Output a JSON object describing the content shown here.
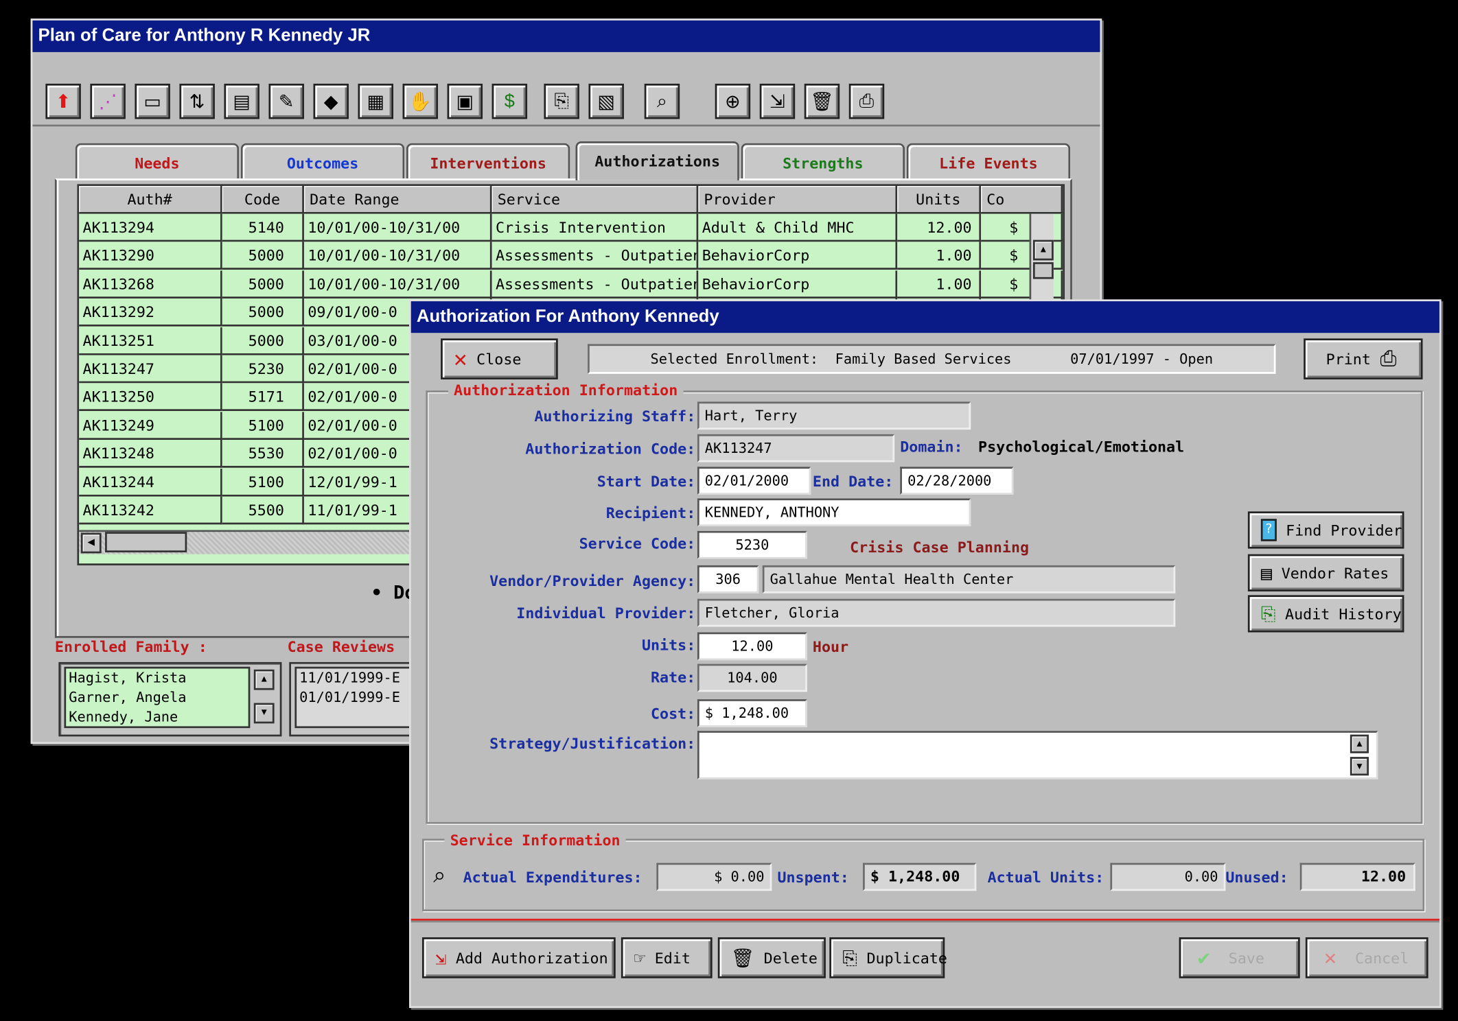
{
  "main_window": {
    "title": "Plan of Care for Anthony R Kennedy JR",
    "toolbar_icons": [
      "up-arrow-icon",
      "flowchart-icon",
      "window-icon",
      "sort-icon",
      "list-icon",
      "form-edit-icon",
      "shapes-icon",
      "cards-icon",
      "handshake-icon",
      "calendar-icon",
      "dollar-icon",
      "copy-icon",
      "preview-icon",
      "magnifier-icon",
      "binoculars-icon",
      "add-doc-icon",
      "trash-icon",
      "printer-icon"
    ],
    "toolbar_glyphs": [
      "⬆",
      "⋰",
      "▭",
      "⇅",
      "▤",
      "✎",
      "◆",
      "▦",
      "✋",
      "▣",
      "$",
      "⎘",
      "▧",
      "⌕",
      "⊕",
      "⇲",
      "🗑",
      "⎙"
    ],
    "tabs": [
      {
        "label": "Needs",
        "color": "#c0171b"
      },
      {
        "label": "Outcomes",
        "color": "#1538d4"
      },
      {
        "label": "Interventions",
        "color": "#a11a1a"
      },
      {
        "label": "Authorizations",
        "color": "#111111"
      },
      {
        "label": "Strengths",
        "color": "#1c7a1c"
      },
      {
        "label": "Life Events",
        "color": "#a11a1a"
      }
    ],
    "table": {
      "headers": [
        "Auth#",
        "Code",
        "Date Range",
        "Service",
        "Provider",
        "Units",
        "Co"
      ],
      "rows": [
        [
          "AK113294",
          "5140",
          "10/01/00-10/31/00",
          "Crisis Intervention",
          "Adult & Child MHC",
          "12.00",
          "$"
        ],
        [
          "AK113290",
          "5000",
          "10/01/00-10/31/00",
          "Assessments - Outpatien",
          "BehaviorCorp",
          "1.00",
          "$"
        ],
        [
          "AK113268",
          "5000",
          "10/01/00-10/31/00",
          "Assessments - Outpatien",
          "BehaviorCorp",
          "1.00",
          "$"
        ],
        [
          "AK113292",
          "5000",
          "09/01/00-0",
          "",
          "",
          "",
          ""
        ],
        [
          "AK113251",
          "5000",
          "03/01/00-0",
          "",
          "",
          "",
          ""
        ],
        [
          "AK113247",
          "5230",
          "02/01/00-0",
          "",
          "",
          "",
          ""
        ],
        [
          "AK113250",
          "5171",
          "02/01/00-0",
          "",
          "",
          "",
          ""
        ],
        [
          "AK113249",
          "5100",
          "02/01/00-0",
          "",
          "",
          "",
          ""
        ],
        [
          "AK113248",
          "5530",
          "02/01/00-0",
          "",
          "",
          "",
          ""
        ],
        [
          "AK113244",
          "5100",
          "12/01/99-1",
          "",
          "",
          "",
          ""
        ],
        [
          "AK113242",
          "5500",
          "11/01/99-1",
          "",
          "",
          "",
          ""
        ]
      ]
    },
    "partial_text": "• Do",
    "enrolled_family": {
      "label": "Enrolled Family :",
      "members": [
        "Hagist, Krista",
        "Garner, Angela",
        "Kennedy, Jane"
      ]
    },
    "case_reviews": {
      "label": "Case Reviews",
      "items": [
        "11/01/1999-E",
        "01/01/1999-E"
      ]
    }
  },
  "dialog": {
    "title": "Authorization For Anthony Kennedy",
    "close_label": "Close",
    "enrollment_text": "Selected Enrollment:  Family Based Services       07/01/1997 - Open",
    "print_label": "Print",
    "auth_info_title": "Authorization Information",
    "fields": {
      "authorizing_staff": {
        "label": "Authorizing Staff:",
        "value": "Hart, Terry"
      },
      "authorization_code": {
        "label": "Authorization Code:",
        "value": "AK113247"
      },
      "domain_label": "Domain:",
      "domain_value": "Psychological/Emotional",
      "start_date": {
        "label": "Start Date:",
        "value": "02/01/2000"
      },
      "end_date": {
        "label": "End Date:",
        "value": "02/28/2000"
      },
      "recipient": {
        "label": "Recipient:",
        "value": "KENNEDY, ANTHONY"
      },
      "service_code": {
        "label": "Service Code:",
        "value": "5230"
      },
      "service_name": "Crisis Case Planning",
      "vendor": {
        "label": "Vendor/Provider Agency:",
        "code": "306",
        "name": "Gallahue Mental Health Center"
      },
      "individual_provider": {
        "label": "Individual Provider:",
        "value": "Fletcher, Gloria"
      },
      "units": {
        "label": "Units:",
        "value": "12.00",
        "unit_name": "Hour"
      },
      "rate": {
        "label": "Rate:",
        "value": "104.00"
      },
      "cost": {
        "label": "Cost:",
        "value": "$ 1,248.00"
      },
      "strategy": {
        "label": "Strategy/Justification:",
        "value": ""
      }
    },
    "side_buttons": {
      "find_provider": "Find Provider",
      "vendor_rates": "Vendor Rates",
      "audit_history": "Audit History"
    },
    "service_info": {
      "title": "Service Information",
      "actual_expenditures_label": "Actual Expenditures:",
      "actual_expenditures_value": "$ 0.00",
      "unspent_label": "Unspent:",
      "unspent_value": "$ 1,248.00",
      "actual_units_label": "Actual Units:",
      "actual_units_value": "0.00",
      "unused_label": "Unused:",
      "unused_value": "12.00"
    },
    "bottom_buttons": {
      "add": "Add Authorization",
      "edit": "Edit",
      "delete": "Delete",
      "duplicate": "Duplicate",
      "save": "Save",
      "cancel": "Cancel"
    }
  }
}
